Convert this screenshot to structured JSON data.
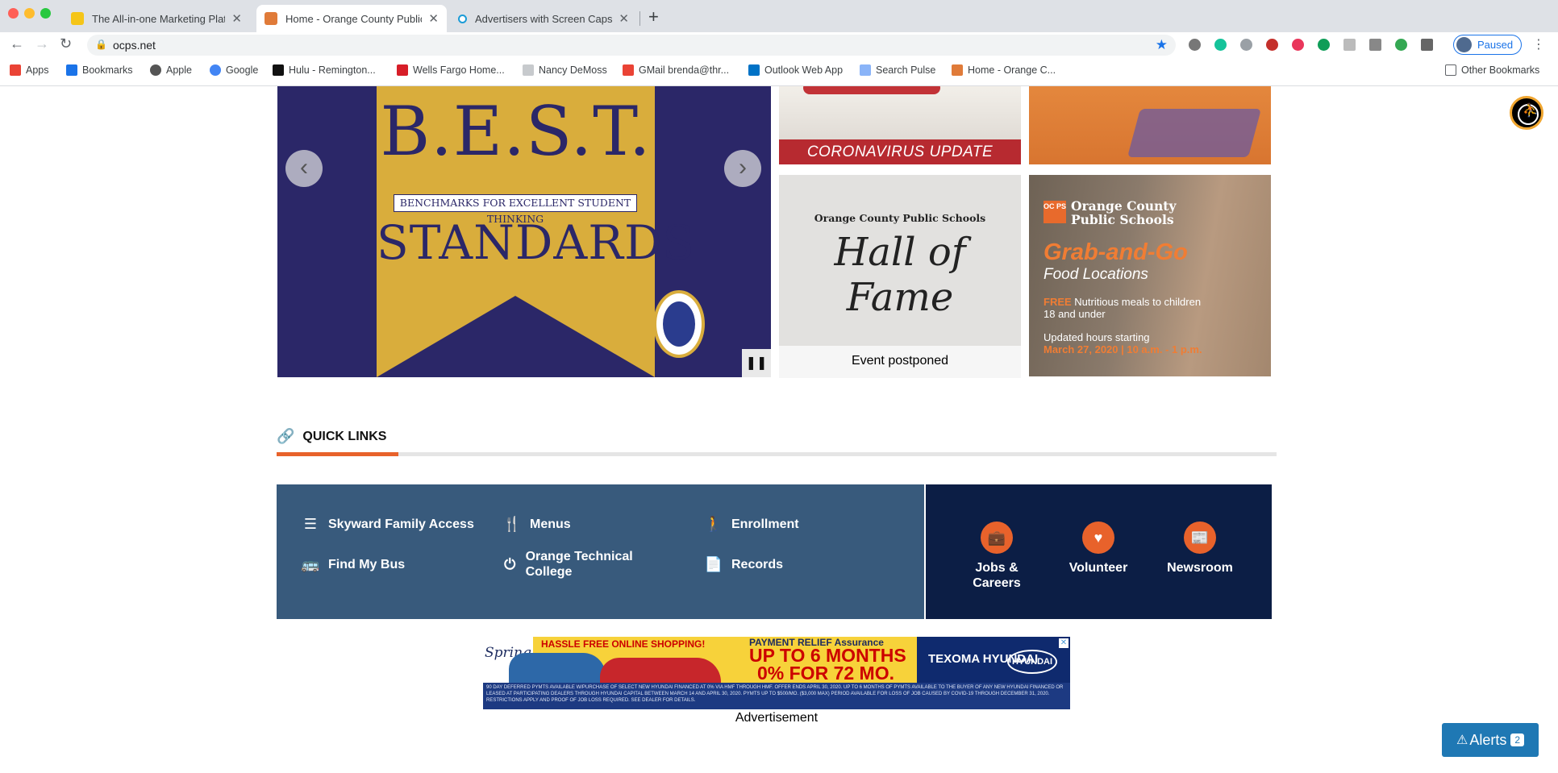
{
  "browser": {
    "tabs": [
      {
        "title": "The All-in-one Marketing Platfo",
        "favicon_color": "#f5c518"
      },
      {
        "title": "Home - Orange County Public",
        "favicon_color": "#e07b39"
      },
      {
        "title": "Advertisers with Screen Caps o",
        "favicon_color": "#1a9bd7"
      }
    ],
    "close_glyph": "✕",
    "new_tab_glyph": "+",
    "url": "ocps.net",
    "profile_label": "Paused",
    "bookmarks": [
      {
        "label": "Apps",
        "icon": "apps-grid-icon",
        "color": "#ea4335"
      },
      {
        "label": "Bookmarks",
        "icon": "star-icon",
        "color": "#1a73e8"
      },
      {
        "label": "Apple",
        "icon": "apple-icon",
        "color": "#555555"
      },
      {
        "label": "Google",
        "icon": "google-icon",
        "color": "#4285f4"
      },
      {
        "label": "Hulu - Remington...",
        "icon": "hulu-icon",
        "color": "#111111"
      },
      {
        "label": "Wells Fargo Home...",
        "icon": "wellsfargo-icon",
        "color": "#d71e28"
      },
      {
        "label": "Nancy DeMoss",
        "icon": "leaf-icon",
        "color": "#9aa0a6"
      },
      {
        "label": "GMail brenda@thr...",
        "icon": "gmail-icon",
        "color": "#ea4335"
      },
      {
        "label": "Outlook Web App",
        "icon": "outlook-icon",
        "color": "#0072c6"
      },
      {
        "label": "Search Pulse",
        "icon": "document-icon",
        "color": "#8ab4f8"
      },
      {
        "label": "Home - Orange C...",
        "icon": "ocps-icon",
        "color": "#e07b39"
      }
    ],
    "other_bookmarks": "Other Bookmarks"
  },
  "slider": {
    "title_main": "B.E.S.T.",
    "subtitle": "BENCHMARKS FOR EXCELLENT STUDENT THINKING",
    "title_sub": "STANDARDS",
    "prev_glyph": "‹",
    "next_glyph": "›",
    "pause_glyph": "❚❚"
  },
  "tiles": {
    "corona": "CORONAVIRUS UPDATE",
    "hof_org": "Orange County Public Schools",
    "hof_title": "Hall of Fame",
    "hof_caption": "Event postponed",
    "grab_logo": "OC PS",
    "grab_org_1": "Orange County",
    "grab_org_2": "Public Schools",
    "grab_title": "Grab-and-Go",
    "grab_sub": "Food Locations",
    "grab_free_b": "FREE",
    "grab_free_text": " Nutritious meals to children",
    "grab_free_text2": "18 and under",
    "grab_updated": "Updated hours starting",
    "grab_date": "March 27, 2020 | 10 a.m. - 1 p.m."
  },
  "quick_links": {
    "heading": "QUICK LINKS",
    "items": [
      {
        "label": "Skyward Family Access",
        "icon": "list-icon"
      },
      {
        "label": "Menus",
        "icon": "fork-knife-icon"
      },
      {
        "label": "Enrollment",
        "icon": "person-icon"
      },
      {
        "label": "Find My Bus",
        "icon": "bus-icon"
      },
      {
        "label": "Orange Technical College",
        "icon": "power-icon"
      },
      {
        "label": "Records",
        "icon": "file-icon"
      }
    ],
    "featured": [
      {
        "label": "Jobs & Careers",
        "icon": "briefcase-icon"
      },
      {
        "label": "Volunteer",
        "icon": "heart-icon"
      },
      {
        "label": "Newsroom",
        "icon": "newspaper-icon"
      }
    ]
  },
  "ad": {
    "spring": "Spring",
    "hassle": "HASSLE FREE ONLINE SHOPPING!",
    "relief": "PAYMENT RELIEF Assurance",
    "months": "UP TO 6 MONTHS",
    "apr": "0% FOR 72 MO.",
    "dealer": "TEXOMA HYUNDAI",
    "brand": "HYUNDAI",
    "fine_print": "90 DAY DEFERRED PYMTS AVAILABLE W/PURCHASE OF SELECT NEW HYUNDAI FINANCED AT 0% VIA HMF THROUGH HMF. OFFER ENDS APRIL 30, 2020. UP TO 6 MONTHS OF PYMTS AVAILABLE TO THE BUYER OF ANY NEW HYUNDAI FINANCED OR LEASED AT PARTICIPATING DEALERS THROUGH HYUNDAI CAPITAL BETWEEN MARCH 14 AND APRIL 30, 2020. PYMTS UP TO $500/MO. ($3,000 MAX) PERIOD AVAILABLE FOR LOSS OF JOB CAUSED BY COVID-19 THROUGH DECEMBER 31, 2020. RESTRICTIONS APPLY AND PROOF OF JOB LOSS REQUIRED. SEE DEALER FOR DETAILS.",
    "ad_choice": "✕",
    "label": "Advertisement"
  },
  "alerts": {
    "label": "Alerts",
    "count": "2"
  }
}
